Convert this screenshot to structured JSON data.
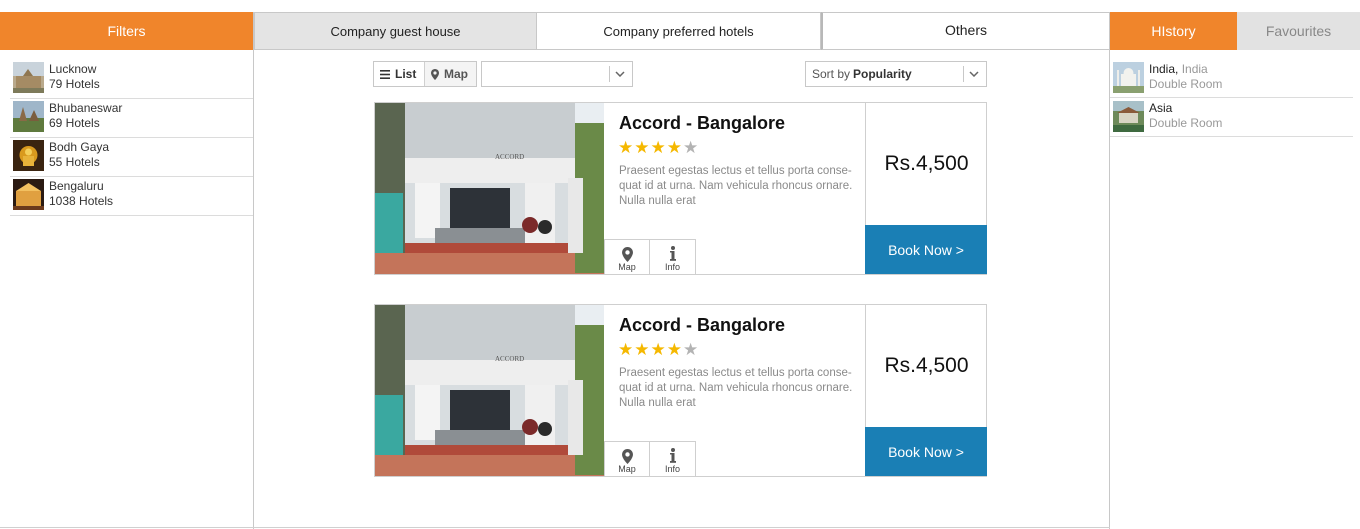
{
  "left_panel": {
    "title": "Filters",
    "cities": [
      {
        "name": "Lucknow",
        "count": "79 Hotels"
      },
      {
        "name": "Bhubaneswar",
        "count": "69 Hotels"
      },
      {
        "name": "Bodh Gaya",
        "count": "55 Hotels"
      },
      {
        "name": "Bengaluru",
        "count": "1038 Hotels"
      }
    ]
  },
  "tabs": [
    "Company guest house",
    "Company preferred hotels",
    "Others"
  ],
  "toolbar": {
    "list_label": "List",
    "map_label": "Map",
    "filter_value": "",
    "sort_label": "Sort by",
    "sort_value": "Popularity"
  },
  "hotels": [
    {
      "name": "Accord - Bangalore",
      "rating": 4,
      "max_rating": 5,
      "description": "Praesent egestas lectus et tellus porta conse-quat id at urna. Nam vehicula rhoncus ornare. Nulla nulla erat",
      "price": "Rs.4,500",
      "book_label": "Book Now >",
      "map_label": "Map",
      "info_label": "Info",
      "sign_text": "ACCORD"
    },
    {
      "name": "Accord - Bangalore",
      "rating": 4,
      "max_rating": 5,
      "description": "Praesent egestas lectus et tellus porta conse-quat id at urna. Nam vehicula rhoncus ornare. Nulla nulla erat",
      "price": "Rs.4,500",
      "book_label": "Book Now >",
      "map_label": "Map",
      "info_label": "Info",
      "sign_text": "ACCORD"
    }
  ],
  "right_panel": {
    "tabs": [
      "HIstory",
      "Favourites"
    ],
    "history": [
      {
        "title": "India,",
        "title_suffix": "India",
        "sub": "Double Room"
      },
      {
        "title": "Asia",
        "title_suffix": "",
        "sub": "Double Room"
      }
    ]
  },
  "colors": {
    "accent_orange": "#f0852b",
    "book_blue": "#1a7fb5",
    "star_gold": "#f5b800"
  }
}
